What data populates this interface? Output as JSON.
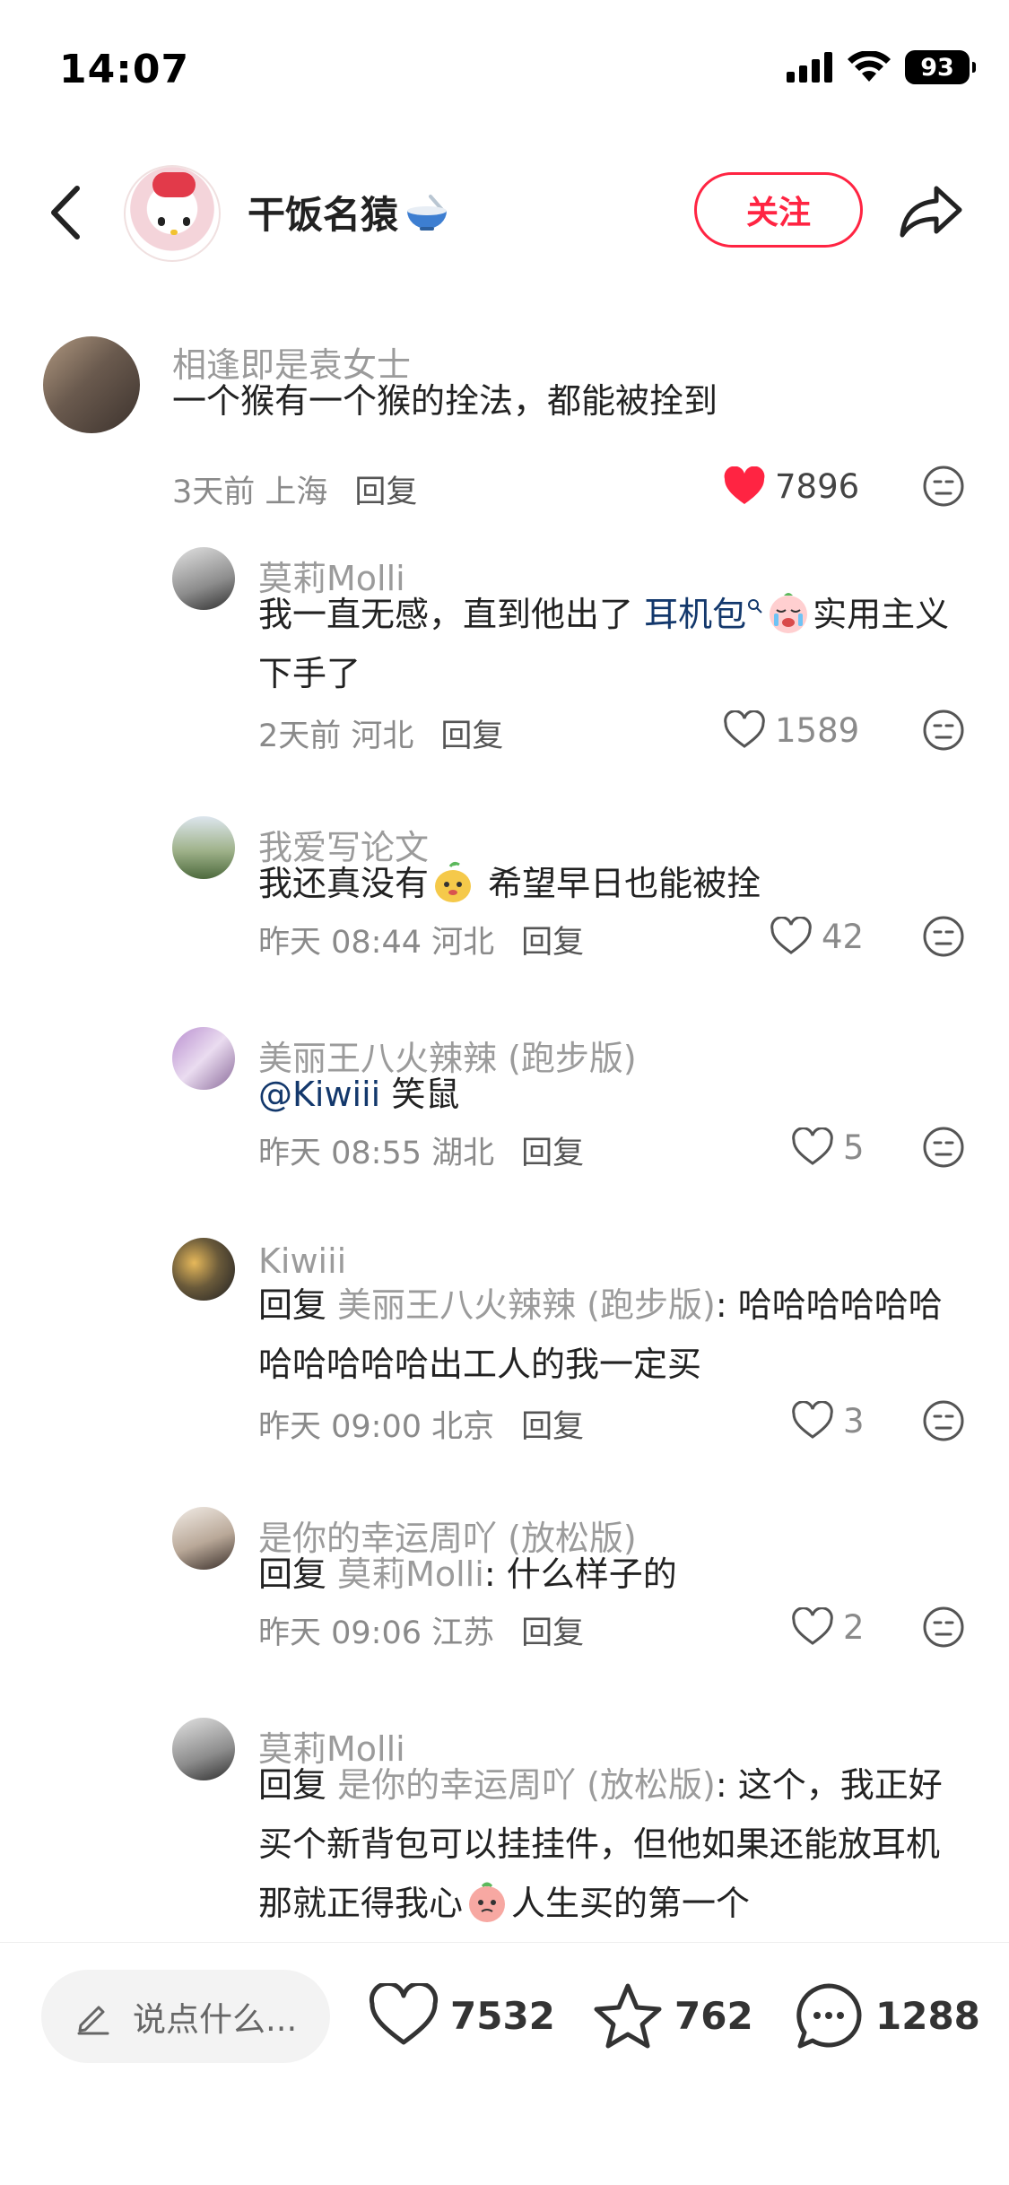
{
  "status_bar": {
    "time": "14:07",
    "battery": "93"
  },
  "header": {
    "author_name": "干饭名猿",
    "follow_label": "关注"
  },
  "comments": [
    {
      "name": "相逢即是袁女士",
      "text": "一个猴有一个猴的拴法，都能被拴到",
      "meta": "3天前 上海",
      "reply_label": "回复",
      "likes": "7896",
      "liked": true
    },
    {
      "name": "莫莉Molli",
      "text_before": "我一直无感，直到他出了 ",
      "link": "耳机包",
      "text_after": "实用主义下手了",
      "meta": "2天前 河北",
      "reply_label": "回复",
      "likes": "1589"
    },
    {
      "name": "我爱写论文",
      "text_before": "我还真没有",
      "text_after": " 希望早日也能被拴",
      "meta": "昨天 08:44 河北",
      "reply_label": "回复",
      "likes": "42"
    },
    {
      "name": "美丽王八火辣辣 (跑步版)",
      "mention": "@Kiwiii",
      "text_after": " 笑鼠",
      "meta": "昨天 08:55 湖北",
      "reply_label": "回复",
      "likes": "5"
    },
    {
      "name": "Kiwiii",
      "reply_prefix": "回复 ",
      "reply_to": "美丽王八火辣辣 (跑步版)",
      "text": ": 哈哈哈哈哈哈哈哈哈哈哈出工人的我一定买",
      "meta": "昨天 09:00 北京",
      "reply_label": "回复",
      "likes": "3"
    },
    {
      "name": "是你的幸运周吖 (放松版)",
      "reply_prefix": "回复 ",
      "reply_to": "莫莉Molli",
      "text": ": 什么样子的",
      "meta": "昨天 09:06 江苏",
      "reply_label": "回复",
      "likes": "2"
    },
    {
      "name": "莫莉Molli",
      "reply_prefix": "回复 ",
      "reply_to": "是你的幸运周吖 (放松版)",
      "text_before": ": 这个，我正好买个新背包可以挂挂件，但他如果还能放耳机那就正得我心",
      "text_after": "人生买的第一个"
    }
  ],
  "bottom_bar": {
    "input_placeholder": "说点什么...",
    "likes": "7532",
    "collects": "762",
    "comments": "1288"
  },
  "colors": {
    "accent": "#ff2442",
    "mention": "#13386c",
    "secondary_text": "#9b9b9b"
  },
  "icons": [
    "back-icon",
    "bowl-emoji-icon",
    "share-icon",
    "heart-icon",
    "dislike-face-icon",
    "search-small-icon",
    "crying-emoji-icon",
    "pear-emoji-icon",
    "peach-emoji-icon",
    "pencil-icon",
    "star-icon",
    "comment-bubble-icon",
    "signal-icon",
    "wifi-icon",
    "battery-icon"
  ]
}
